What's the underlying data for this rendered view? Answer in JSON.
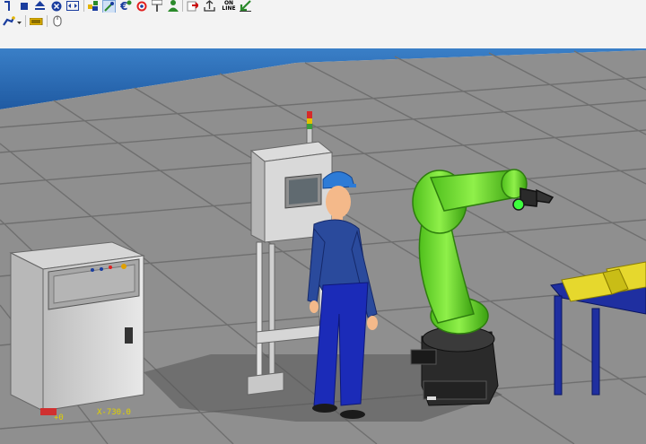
{
  "toolbar": {
    "icons": [
      "program-icon",
      "stop-icon",
      "eject-icon",
      "cancel-icon",
      "fit-view-icon",
      "tool-frame-icon",
      "pick-icon",
      "euro-icon",
      "target-icon",
      "signpost-icon",
      "person-icon",
      "export-icon",
      "upload-icon",
      "online-icon",
      "download-icon"
    ],
    "online_label_top": "ON",
    "online_label_bottom": "LINE",
    "row2_icons": [
      "robot-dropdown-icon",
      "battery-icon",
      "mouse-icon"
    ]
  },
  "viewport": {
    "coord_label_1": "+0",
    "coord_label_2": "X-730.0",
    "colors": {
      "sky": "#2d6fb7",
      "floor": "#8e8e8e",
      "grid": "#6f6f6f",
      "robot": "#6ddb2c",
      "robot_base": "#2a2a2a",
      "conveyor": "#1f2fa0",
      "bins": "#e6d82d",
      "worker_shirt": "#2a4a9c",
      "worker_pants": "#1b2bb8",
      "helmet": "#2d7bd6"
    }
  }
}
